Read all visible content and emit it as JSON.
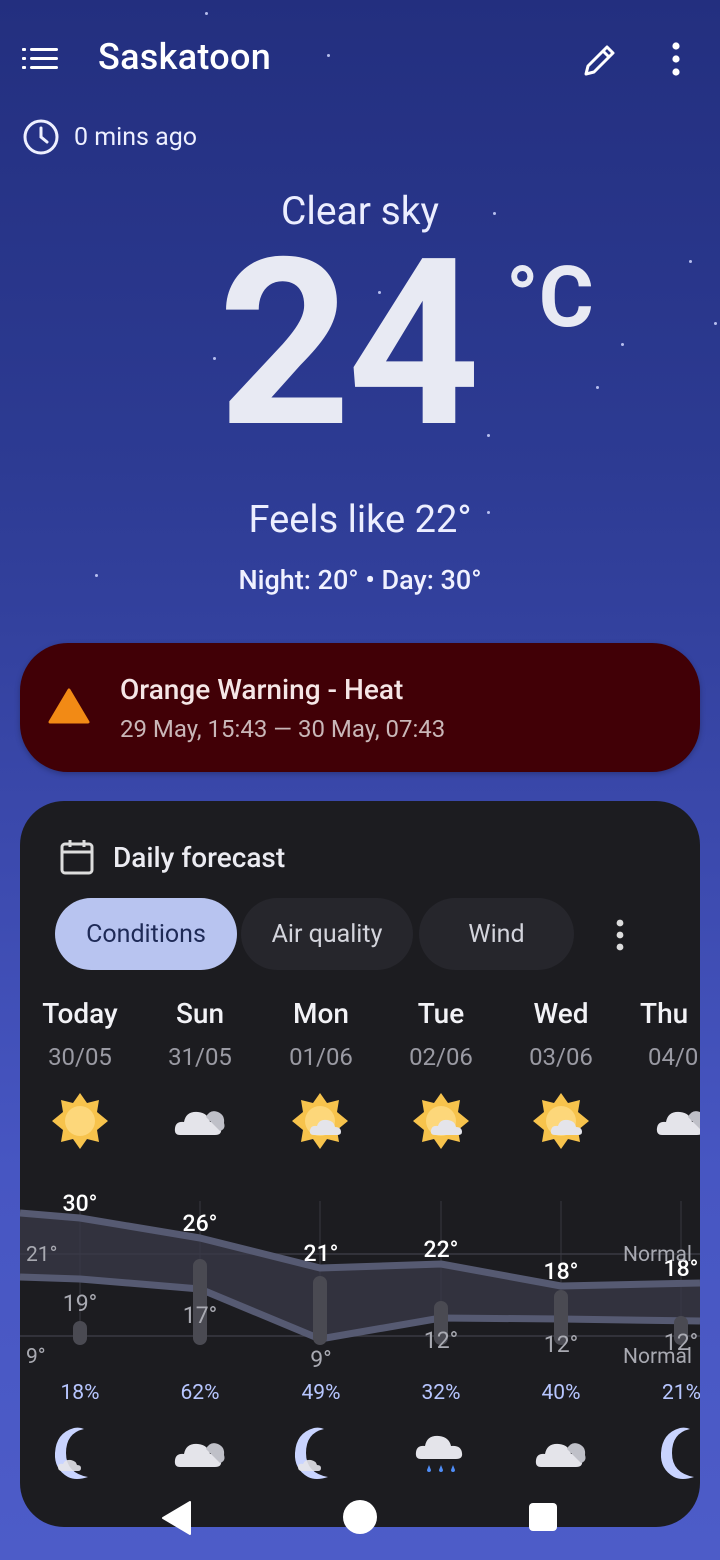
{
  "header": {
    "city": "Saskatoon",
    "updated": "0 mins ago"
  },
  "current": {
    "condition": "Clear sky",
    "temperature": "24",
    "unit": "°C",
    "feels_like": "Feels like 22°",
    "day_night": "Night: 20° • Day: 30°"
  },
  "warning": {
    "title": "Orange Warning - Heat",
    "period": "29 May, 15:43 — 30 May, 07:43",
    "color": "#f28a15"
  },
  "forecast": {
    "title": "Daily forecast",
    "tabs": [
      {
        "label": "Conditions",
        "active": true
      },
      {
        "label": "Air quality",
        "active": false
      },
      {
        "label": "Wind",
        "active": false
      }
    ],
    "days": [
      {
        "name": "Today",
        "date": "30/05",
        "day_icon": "sun-icon",
        "high": "30°",
        "low": "19°",
        "precip": "18%",
        "night_icon": "moon-icon"
      },
      {
        "name": "Sun",
        "date": "31/05",
        "day_icon": "cloud-icon",
        "high": "26°",
        "low": "17°",
        "precip": "62%",
        "night_icon": "cloud-icon"
      },
      {
        "name": "Mon",
        "date": "01/06",
        "day_icon": "sun-cloud-icon",
        "high": "21°",
        "low": "9°",
        "precip": "49%",
        "night_icon": "moon-icon"
      },
      {
        "name": "Tue",
        "date": "02/06",
        "day_icon": "sun-cloud-icon",
        "high": "22°",
        "low": "12°",
        "precip": "32%",
        "night_icon": "rain-cloud-icon"
      },
      {
        "name": "Wed",
        "date": "03/06",
        "day_icon": "sun-cloud-icon",
        "high": "18°",
        "low": "12°",
        "precip": "40%",
        "night_icon": "cloud-icon"
      },
      {
        "name": "Thu",
        "date": "04/0",
        "day_icon": "cloud-icon",
        "high": "18°",
        "low": "12°",
        "precip": "21%",
        "night_icon": "moon-icon"
      }
    ],
    "normal_high": "21°",
    "normal_low": "9°",
    "normal_label": "Normal"
  }
}
